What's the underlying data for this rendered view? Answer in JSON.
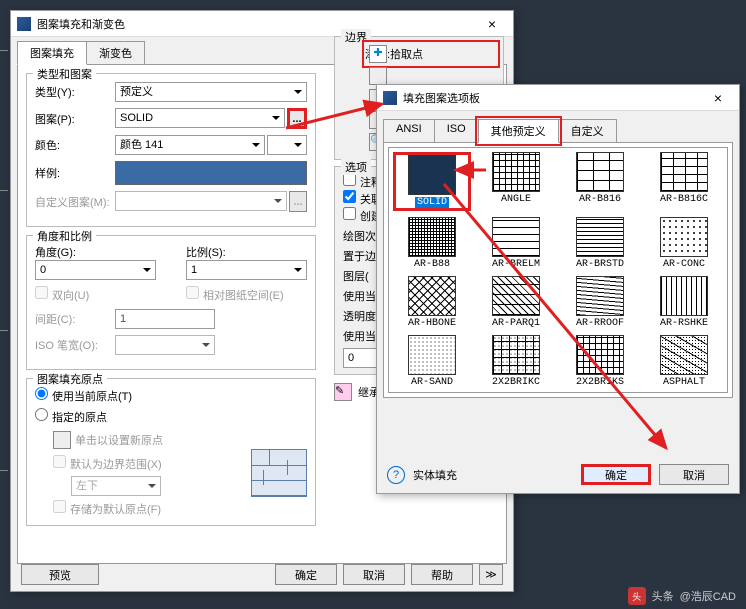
{
  "bg_ticks": [
    50,
    190,
    330,
    470
  ],
  "main": {
    "title": "图案填充和渐变色",
    "tabs": [
      "图案填充",
      "渐变色"
    ],
    "active_tab": 0,
    "grp_type": {
      "legend": "类型和图案",
      "type_lb": "类型(Y):",
      "type_val": "预定义",
      "pattern_lb": "图案(P):",
      "pattern_val": "SOLID",
      "color_lb": "颜色:",
      "color_val": "颜色 141",
      "sample_lb": "样例:",
      "custom_lb": "自定义图案(M):"
    },
    "grp_scale": {
      "legend": "角度和比例",
      "angle_lb": "角度(G):",
      "angle_val": "0",
      "scale_lb": "比例(S):",
      "scale_val": "1",
      "bidir": "双向(U)",
      "relpaper": "相对图纸空间(E)",
      "spacing_lb": "间距(C):",
      "spacing_val": "1",
      "isopen_lb": "ISO 笔宽(O):"
    },
    "grp_origin": {
      "legend": "图案填充原点",
      "use_current": "使用当前原点(T)",
      "specify": "指定的原点",
      "click_set": "单击以设置新原点",
      "default_bound": "默认为边界范围(X)",
      "pos": "左下",
      "store": "存储为默认原点(F)"
    },
    "buttons": {
      "preview": "预览",
      "ok": "确定",
      "cancel": "取消",
      "help": "帮助"
    }
  },
  "right": {
    "boundary": {
      "legend": "边界",
      "add_pick": "添加:拾取点"
    },
    "options": {
      "legend": "选项",
      "annot": "注释",
      "assoc": "关联",
      "create": "创建",
      "draworder_lb": "绘图次",
      "layer_lb": "置于边",
      "layer2": "图层(",
      "use_current": "使用当",
      "trans": "透明度",
      "use_current2": "使用当",
      "val": "0"
    },
    "inherit": "继承特性"
  },
  "palette": {
    "title": "填充图案选项板",
    "tabs": [
      "ANSI",
      "ISO",
      "其他预定义",
      "自定义"
    ],
    "active_tab": 2,
    "patterns": [
      {
        "n": "SOLID",
        "bg": "#1a3350"
      },
      {
        "n": "ANGLE",
        "p": "crosshatch"
      },
      {
        "n": "AR-B816",
        "p": "brick1"
      },
      {
        "n": "AR-B816C",
        "p": "brick2"
      },
      {
        "n": "AR-B88",
        "p": "dense"
      },
      {
        "n": "AR-BRELM",
        "p": "brick3"
      },
      {
        "n": "AR-BRSTD",
        "p": "lines"
      },
      {
        "n": "AR-CONC",
        "p": "dots"
      },
      {
        "n": "AR-HBONE",
        "p": "diag"
      },
      {
        "n": "AR-PARQ1",
        "p": "parq"
      },
      {
        "n": "AR-RROOF",
        "p": "rroof"
      },
      {
        "n": "AR-RSHKE",
        "p": "shake"
      },
      {
        "n": "AR-SAND",
        "p": "sand"
      },
      {
        "n": "2X2BRIKC",
        "p": "b2"
      },
      {
        "n": "2X2BRIKS",
        "p": "b3"
      },
      {
        "n": "ASPHALT",
        "p": "asph"
      }
    ],
    "solid_fill": "实体填充",
    "ok": "确定",
    "cancel": "取消"
  },
  "watermark": {
    "brand": "头条",
    "user": "@浩辰CAD"
  }
}
